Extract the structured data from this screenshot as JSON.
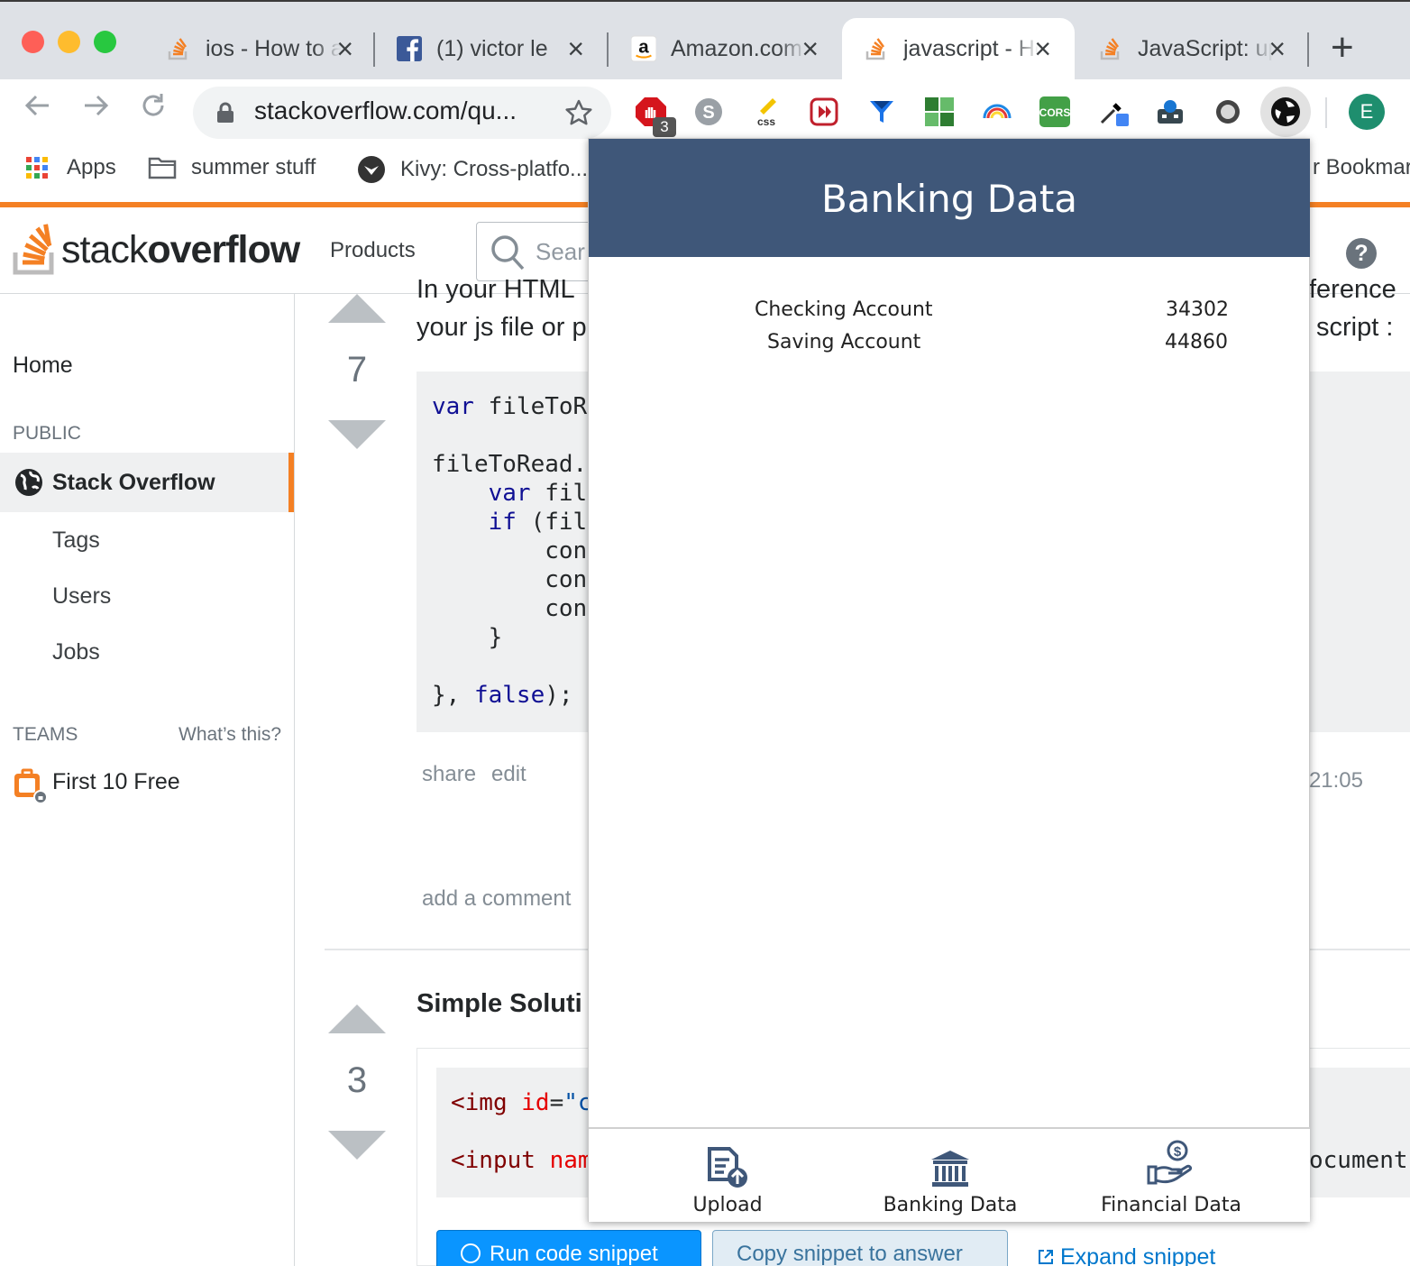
{
  "browser": {
    "tabs": [
      {
        "title": "ios - How to add",
        "favicon": "stackoverflow-icon"
      },
      {
        "title": "(1) victor le",
        "favicon": "facebook-icon"
      },
      {
        "title": "Amazon.com",
        "favicon": "amazon-icon"
      },
      {
        "title": "javascript - How",
        "favicon": "stackoverflow-icon",
        "active": true
      },
      {
        "title": "JavaScript: up",
        "favicon": "stackoverflow-icon"
      }
    ],
    "url": "stackoverflow.com/qu...",
    "extension_badge": "3",
    "profile_initial": "E",
    "bookmarks": {
      "apps": "Apps",
      "folder": "summer stuff",
      "kivy": "Kivy: Cross-platfo...",
      "other": "r Bookmarks"
    }
  },
  "so": {
    "logo_light": "stack",
    "logo_bold": "overflow",
    "products": "Products",
    "search_placeholder": "Search",
    "help": "?",
    "sidebar": {
      "home": "Home",
      "public": "PUBLIC",
      "stack_overflow": "Stack Overflow",
      "tags": "Tags",
      "users": "Users",
      "jobs": "Jobs",
      "teams": "TEAMS",
      "whats_this": "What’s this?",
      "first_free": "First 10 Free"
    },
    "answer1": {
      "votes": "7",
      "text_line1_left": "In your HTML",
      "text_line1_right": "ference",
      "text_line2_left": "your js file or p",
      "text_line2_right": "script :",
      "share": "share",
      "edit": "edit",
      "time": "21:05",
      "add_comment": "add a comment"
    },
    "answer2": {
      "votes": "3",
      "heading": "Simple Soluti",
      "code_right": "ocument.",
      "run": "Run code snippet",
      "copy": "Copy snippet to answer",
      "expand": "Expand snippet"
    }
  },
  "popup": {
    "title": "Banking Data",
    "accounts": [
      {
        "name": "Checking Account",
        "value": "34302"
      },
      {
        "name": "Saving Account",
        "value": "44860"
      }
    ],
    "footer": [
      {
        "label": "Upload",
        "icon": "upload-document-icon"
      },
      {
        "label": "Banking Data",
        "icon": "bank-icon"
      },
      {
        "label": "Financial Data",
        "icon": "hand-dollar-icon"
      }
    ]
  },
  "colors": {
    "popup_header": "#3f5779",
    "so_orange": "#f48024",
    "icon_navy": "#3f5779"
  }
}
